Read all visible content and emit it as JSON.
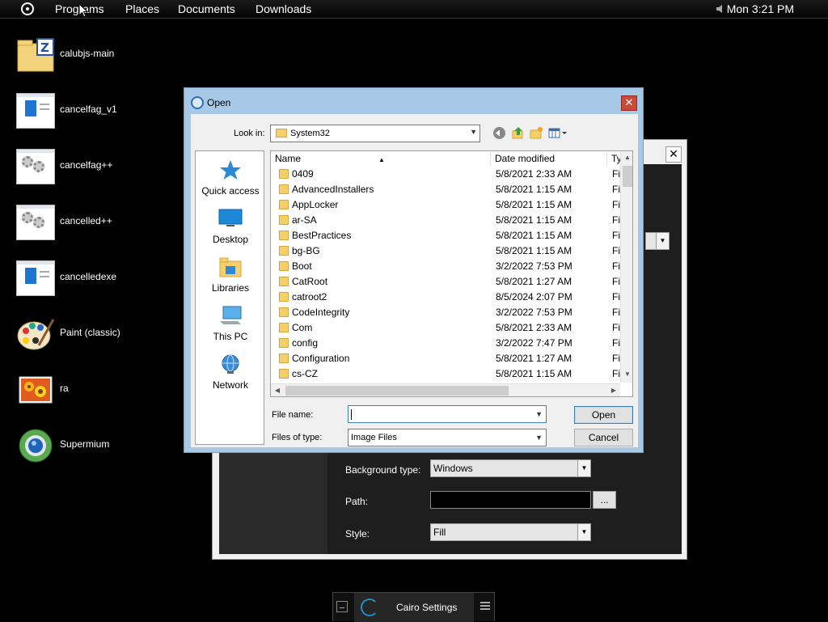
{
  "topbar": {
    "menus": [
      "Programs",
      "Places",
      "Documents",
      "Downloads"
    ],
    "clock": "Mon 3:21 PM"
  },
  "desktop_icons": [
    {
      "label": "calubjs-main",
      "icon": "zip-folder-icon"
    },
    {
      "label": "cancelfag_v1",
      "icon": "window-app-icon"
    },
    {
      "label": "cancelfag++",
      "icon": "gear-app-icon"
    },
    {
      "label": "cancelled++",
      "icon": "gear-app-icon"
    },
    {
      "label": "cancelledexe",
      "icon": "window-app-icon"
    },
    {
      "label": "Paint (classic)",
      "icon": "palette-icon"
    },
    {
      "label": "ra",
      "icon": "flower-image-icon"
    },
    {
      "label": "Supermium",
      "icon": "browser-icon"
    }
  ],
  "settings_window": {
    "close_symbol": "✕",
    "background_type_label": "Background type:",
    "background_type_value": "Windows",
    "path_label": "Path:",
    "path_value": "",
    "browse_label": "...",
    "style_label": "Style:",
    "style_value": "Fill"
  },
  "open_dialog": {
    "title": "Open",
    "close_symbol": "✕",
    "look_in_label": "Look in:",
    "look_in_value": "System32",
    "places": [
      "Quick access",
      "Desktop",
      "Libraries",
      "This PC",
      "Network"
    ],
    "columns": {
      "name": "Name",
      "date": "Date modified",
      "type": "Ty"
    },
    "files": [
      {
        "name": "0409",
        "date": "5/8/2021 2:33 AM",
        "type": "Fil"
      },
      {
        "name": "AdvancedInstallers",
        "date": "5/8/2021 1:15 AM",
        "type": "Fil"
      },
      {
        "name": "AppLocker",
        "date": "5/8/2021 1:15 AM",
        "type": "Fil"
      },
      {
        "name": "ar-SA",
        "date": "5/8/2021 1:15 AM",
        "type": "Fil"
      },
      {
        "name": "BestPractices",
        "date": "5/8/2021 1:15 AM",
        "type": "Fil"
      },
      {
        "name": "bg-BG",
        "date": "5/8/2021 1:15 AM",
        "type": "Fil"
      },
      {
        "name": "Boot",
        "date": "3/2/2022 7:53 PM",
        "type": "Fil"
      },
      {
        "name": "CatRoot",
        "date": "5/8/2021 1:27 AM",
        "type": "Fil"
      },
      {
        "name": "catroot2",
        "date": "8/5/2024 2:07 PM",
        "type": "Fil"
      },
      {
        "name": "CodeIntegrity",
        "date": "3/2/2022 7:53 PM",
        "type": "Fil"
      },
      {
        "name": "Com",
        "date": "5/8/2021 2:33 AM",
        "type": "Fil"
      },
      {
        "name": "config",
        "date": "3/2/2022 7:47 PM",
        "type": "Fil"
      },
      {
        "name": "Configuration",
        "date": "5/8/2021 1:27 AM",
        "type": "Fil"
      },
      {
        "name": "cs-CZ",
        "date": "5/8/2021 1:15 AM",
        "type": "Fil"
      }
    ],
    "file_name_label": "File name:",
    "file_name_value": "",
    "file_type_label": "Files of type:",
    "file_type_value": "Image Files",
    "open_button": "Open",
    "cancel_button": "Cancel"
  },
  "taskbar": {
    "task_label": "Cairo Settings"
  },
  "colors": {
    "dialog_frame": "#a8c8e8",
    "close_red": "#c84a3a",
    "folder_yellow": "#f4cf6b",
    "accent_blue": "#1e90c8"
  }
}
